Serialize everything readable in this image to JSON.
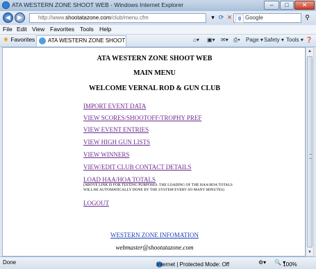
{
  "window": {
    "title": "ATA WESTERN ZONE SHOOT WEB - Windows Internet Explorer",
    "minimize": "–",
    "maximize": "□",
    "close": "✕"
  },
  "address": {
    "url_prefix": "http://www.",
    "url_domain": "shootatazone.com",
    "url_path": "/club/menu.cfm",
    "search_provider": "Google"
  },
  "menu": [
    "File",
    "Edit",
    "View",
    "Favorites",
    "Tools",
    "Help"
  ],
  "favorites_bar": {
    "favorites_label": "Favorites",
    "tab_title": "ATA WESTERN ZONE SHOOT WEB",
    "page_label": "Page ▾",
    "safety_label": "Safety ▾",
    "tools_label": "Tools ▾"
  },
  "page": {
    "heading1": "ATA WESTERN ZONE SHOOT WEB",
    "heading2": "MAIN MENU",
    "heading3": "WELCOME VERNAL ROD & GUN CLUB",
    "links": [
      "IMPORT EVENT DATA",
      "VIEW SCORES/SHOOTOFF/TROPHY PREF",
      "VIEW EVENT ENTRIES",
      "VIEW HIGH GUN LISTS",
      "VIEW WINNERS",
      "VIEW/EDIT CLUB CONTACT DETAILS",
      "LOAD HAA/HOA TOTALS",
      "LOGOUT"
    ],
    "note_line1": "(ABOVE LINK IS FOR TESTING PURPOSES. THE LOADING OF THE HAA/HOA TOTALS",
    "note_line2": "WILL BE AUTOMATICALLY DONE BY THE SYSTEM EVERY SO MANY MINUTES)",
    "footer_link": "WESTERN ZONE INFOMATION",
    "footer_email": "webmaster@shootatazone.com"
  },
  "status": {
    "left": "Done",
    "zone": "Internet | Protected Mode: Off",
    "zoom": "100%"
  },
  "colors": {
    "visited_link": "#6b2a8f",
    "footer_link": "#1a3fb8"
  }
}
